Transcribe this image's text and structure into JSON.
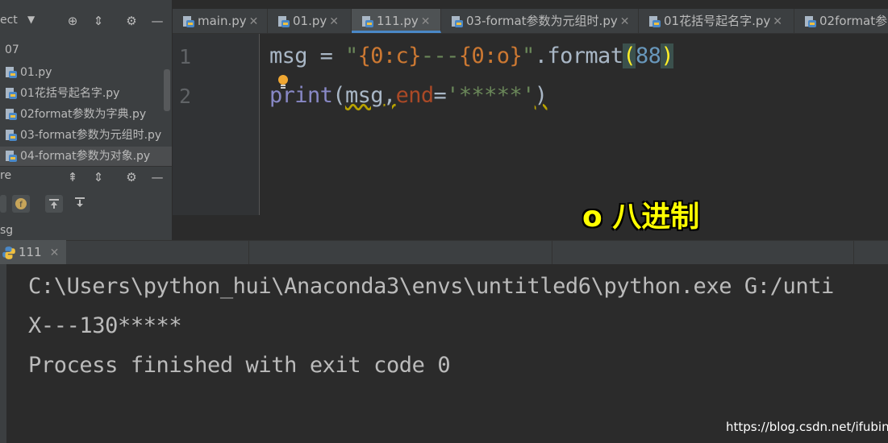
{
  "project_panel": {
    "title": "ect",
    "folder": "07",
    "files": [
      "01.py",
      "01花括号起名字.py",
      "02format参数为字典.py",
      "03-format参数为元组时.py",
      "04-format参数为对象.py"
    ]
  },
  "structure_panel": {
    "title": "re",
    "item": "sg"
  },
  "tabs": [
    {
      "label": "main.py"
    },
    {
      "label": "01.py"
    },
    {
      "label": "111.py"
    },
    {
      "label": "03-format参数为元组时.py"
    },
    {
      "label": "01花括号起名字.py"
    },
    {
      "label": "02format参"
    }
  ],
  "editor": {
    "line_numbers": [
      "1",
      "2"
    ],
    "line1": {
      "var": "msg = ",
      "q1": "\"",
      "f1": "{0:c}",
      "mid": "---",
      "f2": "{0:o}",
      "q2": "\"",
      "method": ".format",
      "open": "(",
      "num": "88",
      "close": ")"
    },
    "line2": {
      "fn": "print",
      "open": "(",
      "arg": "msg,",
      "kw": "end",
      "eq": "=",
      "str": "'*****'",
      "close": ")"
    }
  },
  "annotation": "o 八进制",
  "run": {
    "tab_label": "111",
    "output": [
      "C:\\Users\\python_hui\\Anaconda3\\envs\\untitled6\\python.exe G:/unti",
      "X---130*****",
      "Process finished with exit code 0"
    ]
  },
  "watermark": "https://blog.csdn.net/ifubing",
  "colors": {
    "accent": "#4a88c7",
    "annotation": "#ffff00"
  }
}
